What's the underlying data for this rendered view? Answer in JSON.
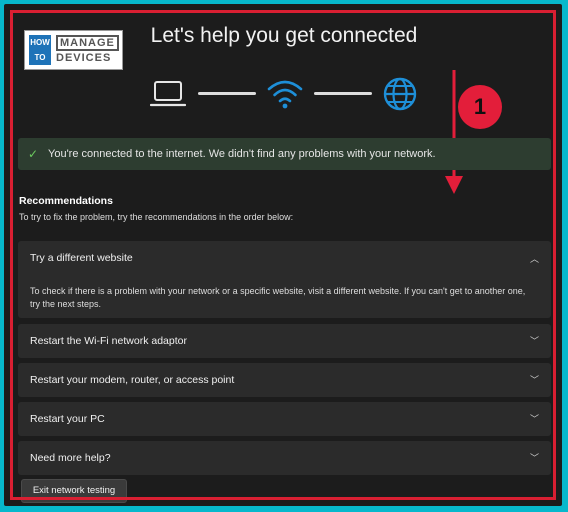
{
  "logo": {
    "how": "HOW",
    "to": "TO",
    "manage": "MANAGE",
    "devices": "DEVICES"
  },
  "title": "Let's help you get connected",
  "annotation": {
    "number": "1"
  },
  "status": {
    "message": "You're connected to the internet. We didn't find any problems with your network."
  },
  "recommendations": {
    "heading": "Recommendations",
    "subtext": "To try to fix the problem, try the recommendations in the order below:",
    "items": [
      {
        "label": "Try a different website",
        "expanded": true,
        "body": "To check if there is a problem with your network or a specific website, visit a different website. If you can't get to another one, try the next steps."
      },
      {
        "label": "Restart the Wi-Fi network adaptor",
        "expanded": false
      },
      {
        "label": "Restart your modem, router, or access point",
        "expanded": false
      },
      {
        "label": "Restart your PC",
        "expanded": false
      },
      {
        "label": "Need more help?",
        "expanded": false
      }
    ]
  },
  "exit_button": "Exit network testing",
  "colors": {
    "accent": "#1e8fd8",
    "annotation": "#e31e3a",
    "success": "#6ccb5f",
    "border": "#d91f32"
  }
}
